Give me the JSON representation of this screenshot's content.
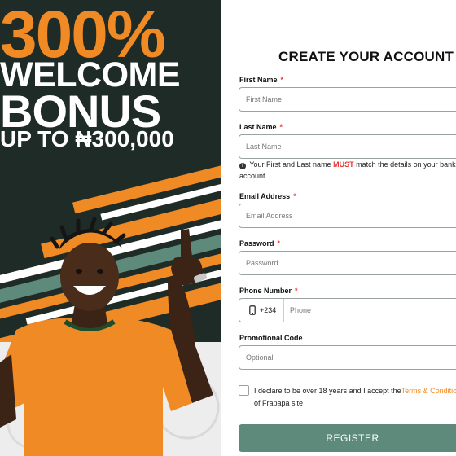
{
  "promo": {
    "line1": "300%",
    "line2": "WELCOME",
    "line3": "BONUS",
    "line4": "UP TO ₦300,000",
    "accent_color": "#f08a24",
    "background_color": "#1f2b27"
  },
  "form": {
    "title": "CREATE YOUR ACCOUNT",
    "required_marker": "*",
    "first_name": {
      "label": "First Name",
      "placeholder": "First Name"
    },
    "last_name": {
      "label": "Last Name",
      "placeholder": "Last Name"
    },
    "name_note": {
      "icon": "info-icon",
      "text_before": "Your First and Last name ",
      "emphasis": "MUST",
      "text_after": " match the details on your bank account."
    },
    "email": {
      "label": "Email Address",
      "placeholder": "Email Address"
    },
    "password": {
      "label": "Password",
      "placeholder": "Password"
    },
    "phone": {
      "label": "Phone Number",
      "icon": "phone-icon",
      "country_code": "+234",
      "placeholder": "Phone"
    },
    "promo_code": {
      "label": "Promotional Code",
      "placeholder": "Optional"
    },
    "declaration": {
      "text_before": "I declare to be over 18 years and I accept the",
      "link_text": "Terms & Conditions",
      "text_after": " of Frapapa site",
      "checked": false
    },
    "register_label": "REGISTER",
    "button_color": "#5e8a7c",
    "required_color": "#e53935"
  }
}
